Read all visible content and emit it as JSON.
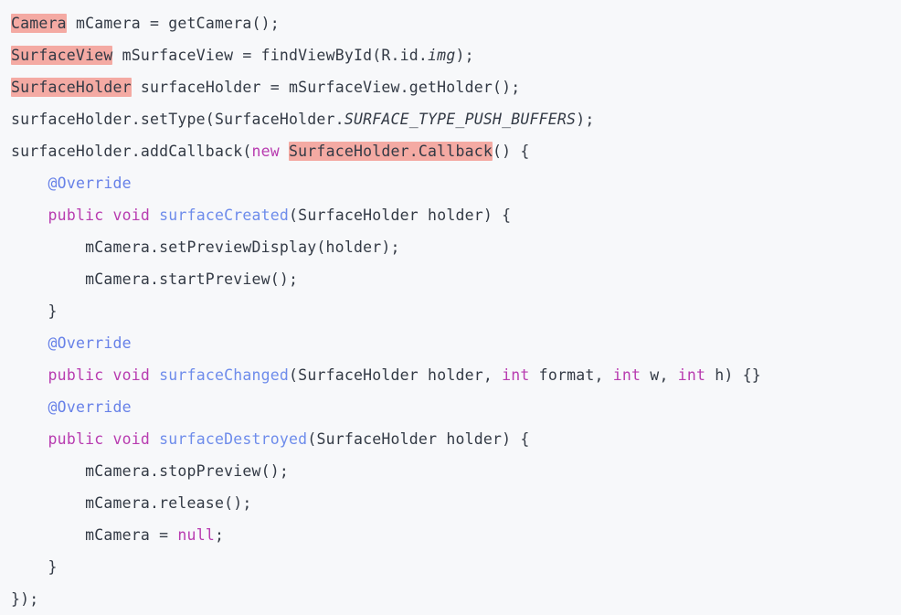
{
  "document": {
    "kind": "code-snippet",
    "language": "Java",
    "background_color": "#f7f8fa",
    "text_color": "#333a45",
    "highlight_color": "#f4aaa3",
    "keyword_color": "#b83cb0",
    "annotation_color": "#6781e8",
    "function_color": "#6e8ceb",
    "line_count": 17
  },
  "lines": [
    {
      "id": "line-1",
      "plain": "Camera mCamera = getCamera();",
      "tokens": [
        {
          "text": "Camera",
          "style": "hl"
        },
        {
          "text": " mCamera = getCamera();",
          "style": "plain"
        }
      ]
    },
    {
      "id": "line-2",
      "plain": "SurfaceView mSurfaceView = findViewById(R.id.img);",
      "tokens": [
        {
          "text": "SurfaceView",
          "style": "hl"
        },
        {
          "text": " mSurfaceView = findViewById(R.id.",
          "style": "plain"
        },
        {
          "text": "img",
          "style": "italic"
        },
        {
          "text": ");",
          "style": "plain"
        }
      ]
    },
    {
      "id": "line-3",
      "plain": "SurfaceHolder surfaceHolder = mSurfaceView.getHolder();",
      "tokens": [
        {
          "text": "SurfaceHolder",
          "style": "hl"
        },
        {
          "text": " surfaceHolder = mSurfaceView.getHolder();",
          "style": "plain"
        }
      ]
    },
    {
      "id": "line-4",
      "plain": "surfaceHolder.setType(SurfaceHolder.SURFACE_TYPE_PUSH_BUFFERS);",
      "tokens": [
        {
          "text": "surfaceHolder.setType(SurfaceHolder.",
          "style": "plain"
        },
        {
          "text": "SURFACE_TYPE_PUSH_BUFFERS",
          "style": "italic"
        },
        {
          "text": ");",
          "style": "plain"
        }
      ]
    },
    {
      "id": "line-5",
      "plain": "surfaceHolder.addCallback(new SurfaceHolder.Callback() {",
      "tokens": [
        {
          "text": "surfaceHolder.addCallback(",
          "style": "plain"
        },
        {
          "text": "new",
          "style": "keyword"
        },
        {
          "text": " ",
          "style": "plain"
        },
        {
          "text": "SurfaceHolder.Callback",
          "style": "hl"
        },
        {
          "text": "() {",
          "style": "plain"
        }
      ]
    },
    {
      "id": "line-6",
      "plain": "    @Override",
      "tokens": [
        {
          "text": "    ",
          "style": "plain"
        },
        {
          "text": "@Override",
          "style": "annotation"
        }
      ]
    },
    {
      "id": "line-7",
      "plain": "    public void surfaceCreated(SurfaceHolder holder) {",
      "tokens": [
        {
          "text": "    ",
          "style": "plain"
        },
        {
          "text": "public void",
          "style": "keyword"
        },
        {
          "text": " ",
          "style": "plain"
        },
        {
          "text": "surfaceCreated",
          "style": "function"
        },
        {
          "text": "(SurfaceHolder holder) {",
          "style": "plain"
        }
      ]
    },
    {
      "id": "line-8",
      "plain": "        mCamera.setPreviewDisplay(holder);",
      "tokens": [
        {
          "text": "        mCamera.setPreviewDisplay(holder);",
          "style": "plain"
        }
      ]
    },
    {
      "id": "line-9",
      "plain": "        mCamera.startPreview();",
      "tokens": [
        {
          "text": "        mCamera.startPreview();",
          "style": "plain"
        }
      ]
    },
    {
      "id": "line-10",
      "plain": "    }",
      "tokens": [
        {
          "text": "    }",
          "style": "plain"
        }
      ]
    },
    {
      "id": "line-11",
      "plain": "    @Override",
      "tokens": [
        {
          "text": "    ",
          "style": "plain"
        },
        {
          "text": "@Override",
          "style": "annotation"
        }
      ]
    },
    {
      "id": "line-12",
      "plain": "    public void surfaceChanged(SurfaceHolder holder, int format, int w, int h) {}",
      "tokens": [
        {
          "text": "    ",
          "style": "plain"
        },
        {
          "text": "public void",
          "style": "keyword"
        },
        {
          "text": " ",
          "style": "plain"
        },
        {
          "text": "surfaceChanged",
          "style": "function"
        },
        {
          "text": "(SurfaceHolder holder, ",
          "style": "plain"
        },
        {
          "text": "int",
          "style": "keyword"
        },
        {
          "text": " format, ",
          "style": "plain"
        },
        {
          "text": "int",
          "style": "keyword"
        },
        {
          "text": " w, ",
          "style": "plain"
        },
        {
          "text": "int",
          "style": "keyword"
        },
        {
          "text": " h) {}",
          "style": "plain"
        }
      ]
    },
    {
      "id": "line-13",
      "plain": "    @Override",
      "tokens": [
        {
          "text": "    ",
          "style": "plain"
        },
        {
          "text": "@Override",
          "style": "annotation"
        }
      ]
    },
    {
      "id": "line-14",
      "plain": "    public void surfaceDestroyed(SurfaceHolder holder) {",
      "tokens": [
        {
          "text": "    ",
          "style": "plain"
        },
        {
          "text": "public void",
          "style": "keyword"
        },
        {
          "text": " ",
          "style": "plain"
        },
        {
          "text": "surfaceDestroyed",
          "style": "function"
        },
        {
          "text": "(SurfaceHolder holder) {",
          "style": "plain"
        }
      ]
    },
    {
      "id": "line-15",
      "plain": "        mCamera.stopPreview();",
      "tokens": [
        {
          "text": "        mCamera.stopPreview();",
          "style": "plain"
        }
      ]
    },
    {
      "id": "line-16",
      "plain": "        mCamera.release();",
      "tokens": [
        {
          "text": "        mCamera.release();",
          "style": "plain"
        }
      ]
    },
    {
      "id": "line-17",
      "plain": "        mCamera = null;",
      "tokens": [
        {
          "text": "        mCamera = ",
          "style": "plain"
        },
        {
          "text": "null",
          "style": "keyword"
        },
        {
          "text": ";",
          "style": "plain"
        }
      ]
    },
    {
      "id": "line-18",
      "plain": "    }",
      "tokens": [
        {
          "text": "    }",
          "style": "plain"
        }
      ]
    },
    {
      "id": "line-19",
      "plain": "});",
      "tokens": [
        {
          "text": "});",
          "style": "plain"
        }
      ]
    }
  ]
}
